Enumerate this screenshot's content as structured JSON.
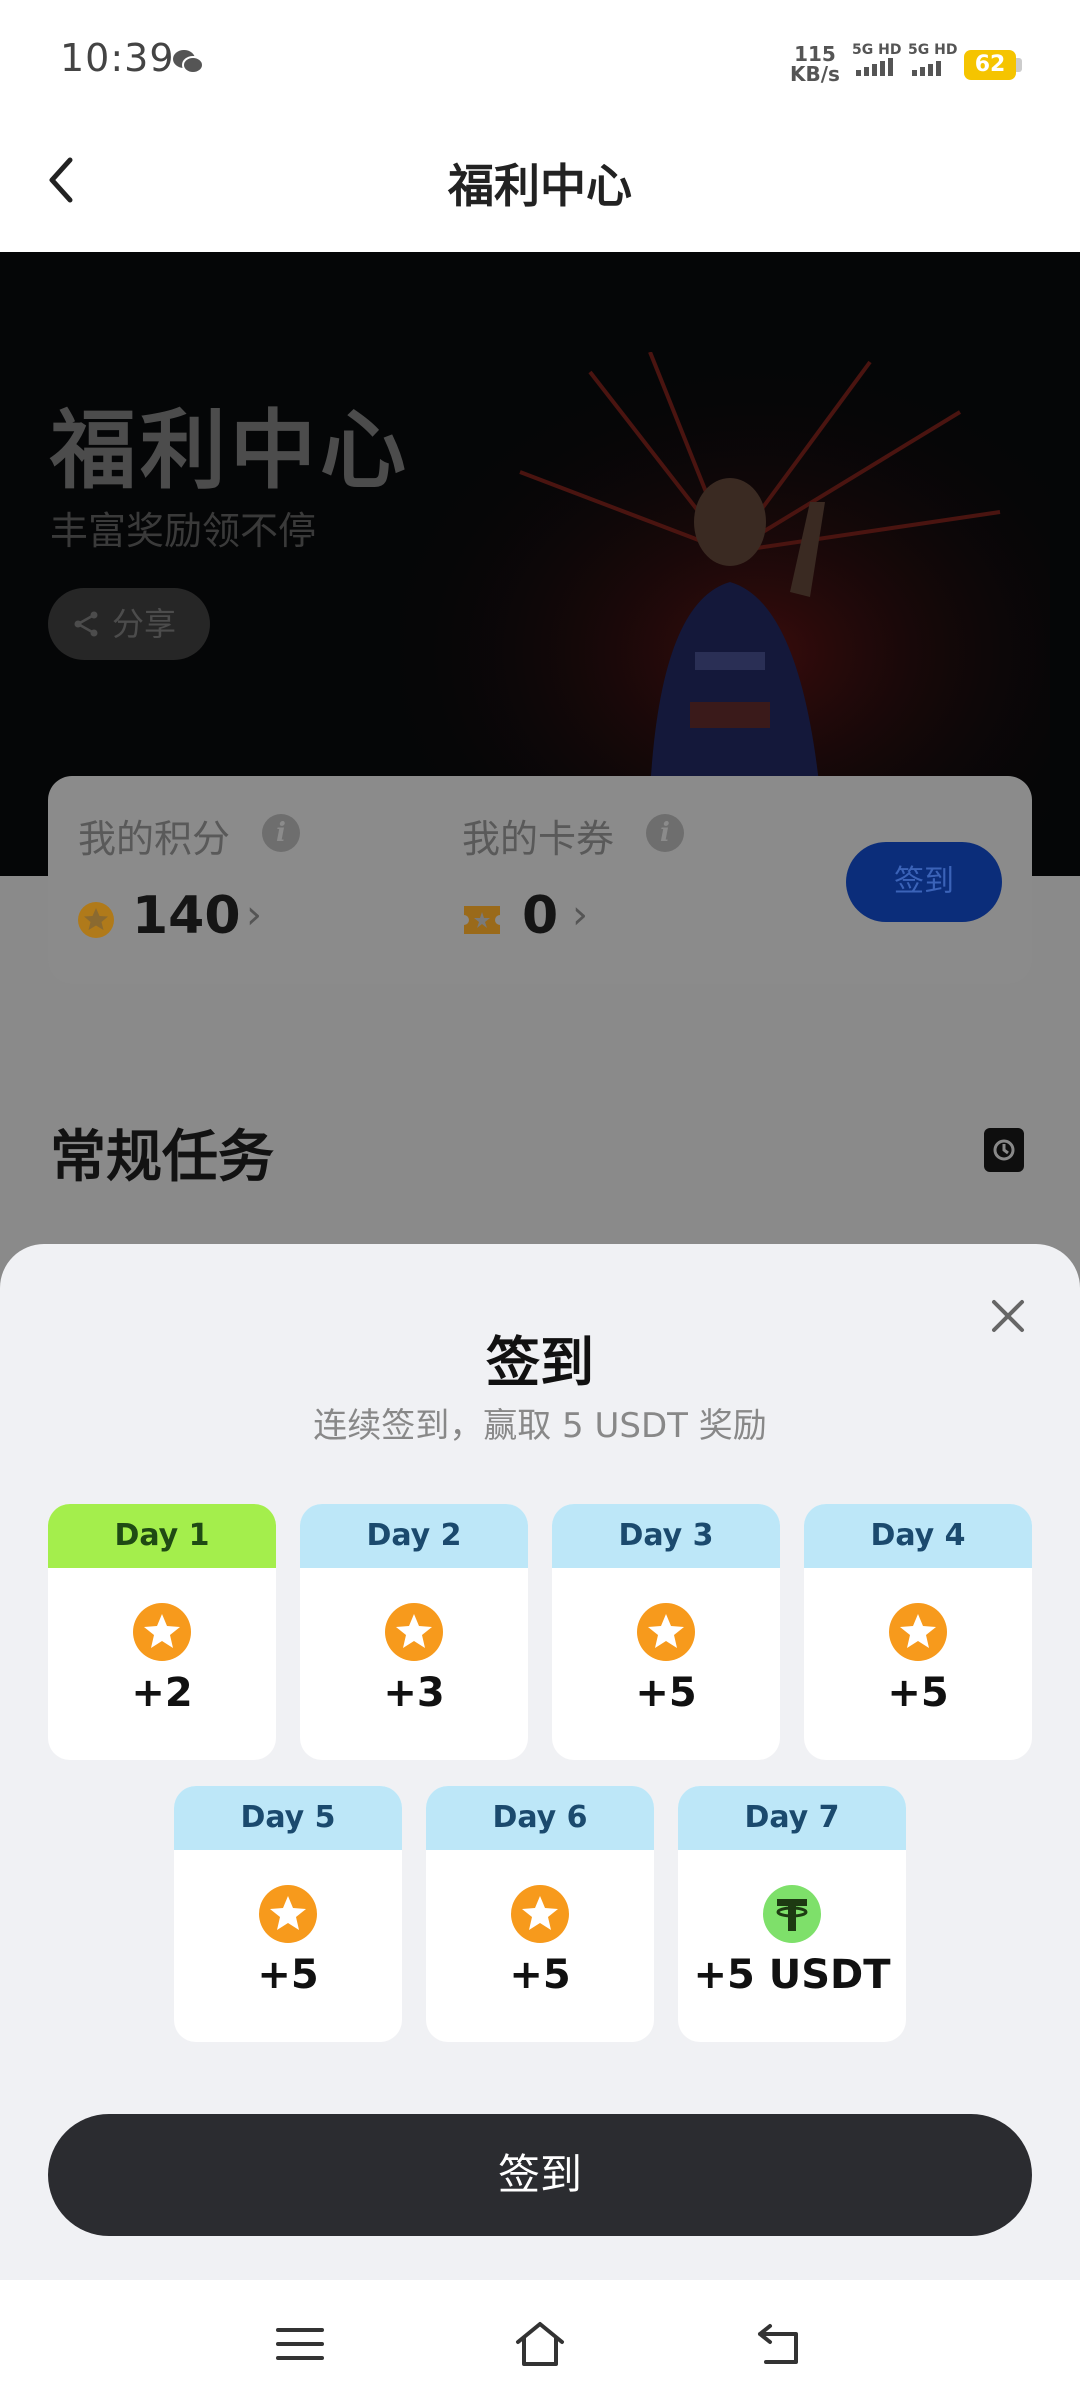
{
  "status_bar": {
    "time": "10:39",
    "net_speed_value": "115",
    "net_speed_unit": "KB/s",
    "signal1": "5G HD",
    "signal2": "5G HD",
    "battery": "62"
  },
  "header": {
    "title": "福利中心"
  },
  "hero": {
    "title": "福利中心",
    "subtitle": "丰富奖励领不停",
    "share_label": "分享"
  },
  "points_card": {
    "points_label": "我的积分",
    "points_value": "140",
    "coupons_label": "我的卡券",
    "coupons_value": "0",
    "signin_label": "签到"
  },
  "tasks": {
    "title": "常规任务"
  },
  "sheet": {
    "title": "签到",
    "subtitle": "连续签到，赢取 5 USDT 奖励",
    "days": [
      {
        "label": "Day 1",
        "reward": "+2",
        "icon": "star-coin-icon",
        "active": true
      },
      {
        "label": "Day 2",
        "reward": "+3",
        "icon": "star-coin-icon"
      },
      {
        "label": "Day 3",
        "reward": "+5",
        "icon": "star-coin-icon"
      },
      {
        "label": "Day 4",
        "reward": "+5",
        "icon": "star-coin-icon"
      },
      {
        "label": "Day 5",
        "reward": "+5",
        "icon": "star-coin-icon"
      },
      {
        "label": "Day 6",
        "reward": "+5",
        "icon": "star-coin-icon"
      },
      {
        "label": "Day 7",
        "reward": "+5 USDT",
        "icon": "usdt-icon"
      }
    ],
    "button_label": "签到"
  },
  "colors": {
    "active_day": "#a4ee4c",
    "day_header": "#bde7f8",
    "coin": "#f79a1c",
    "usdt": "#7ee06a",
    "button": "#2b2c30"
  }
}
